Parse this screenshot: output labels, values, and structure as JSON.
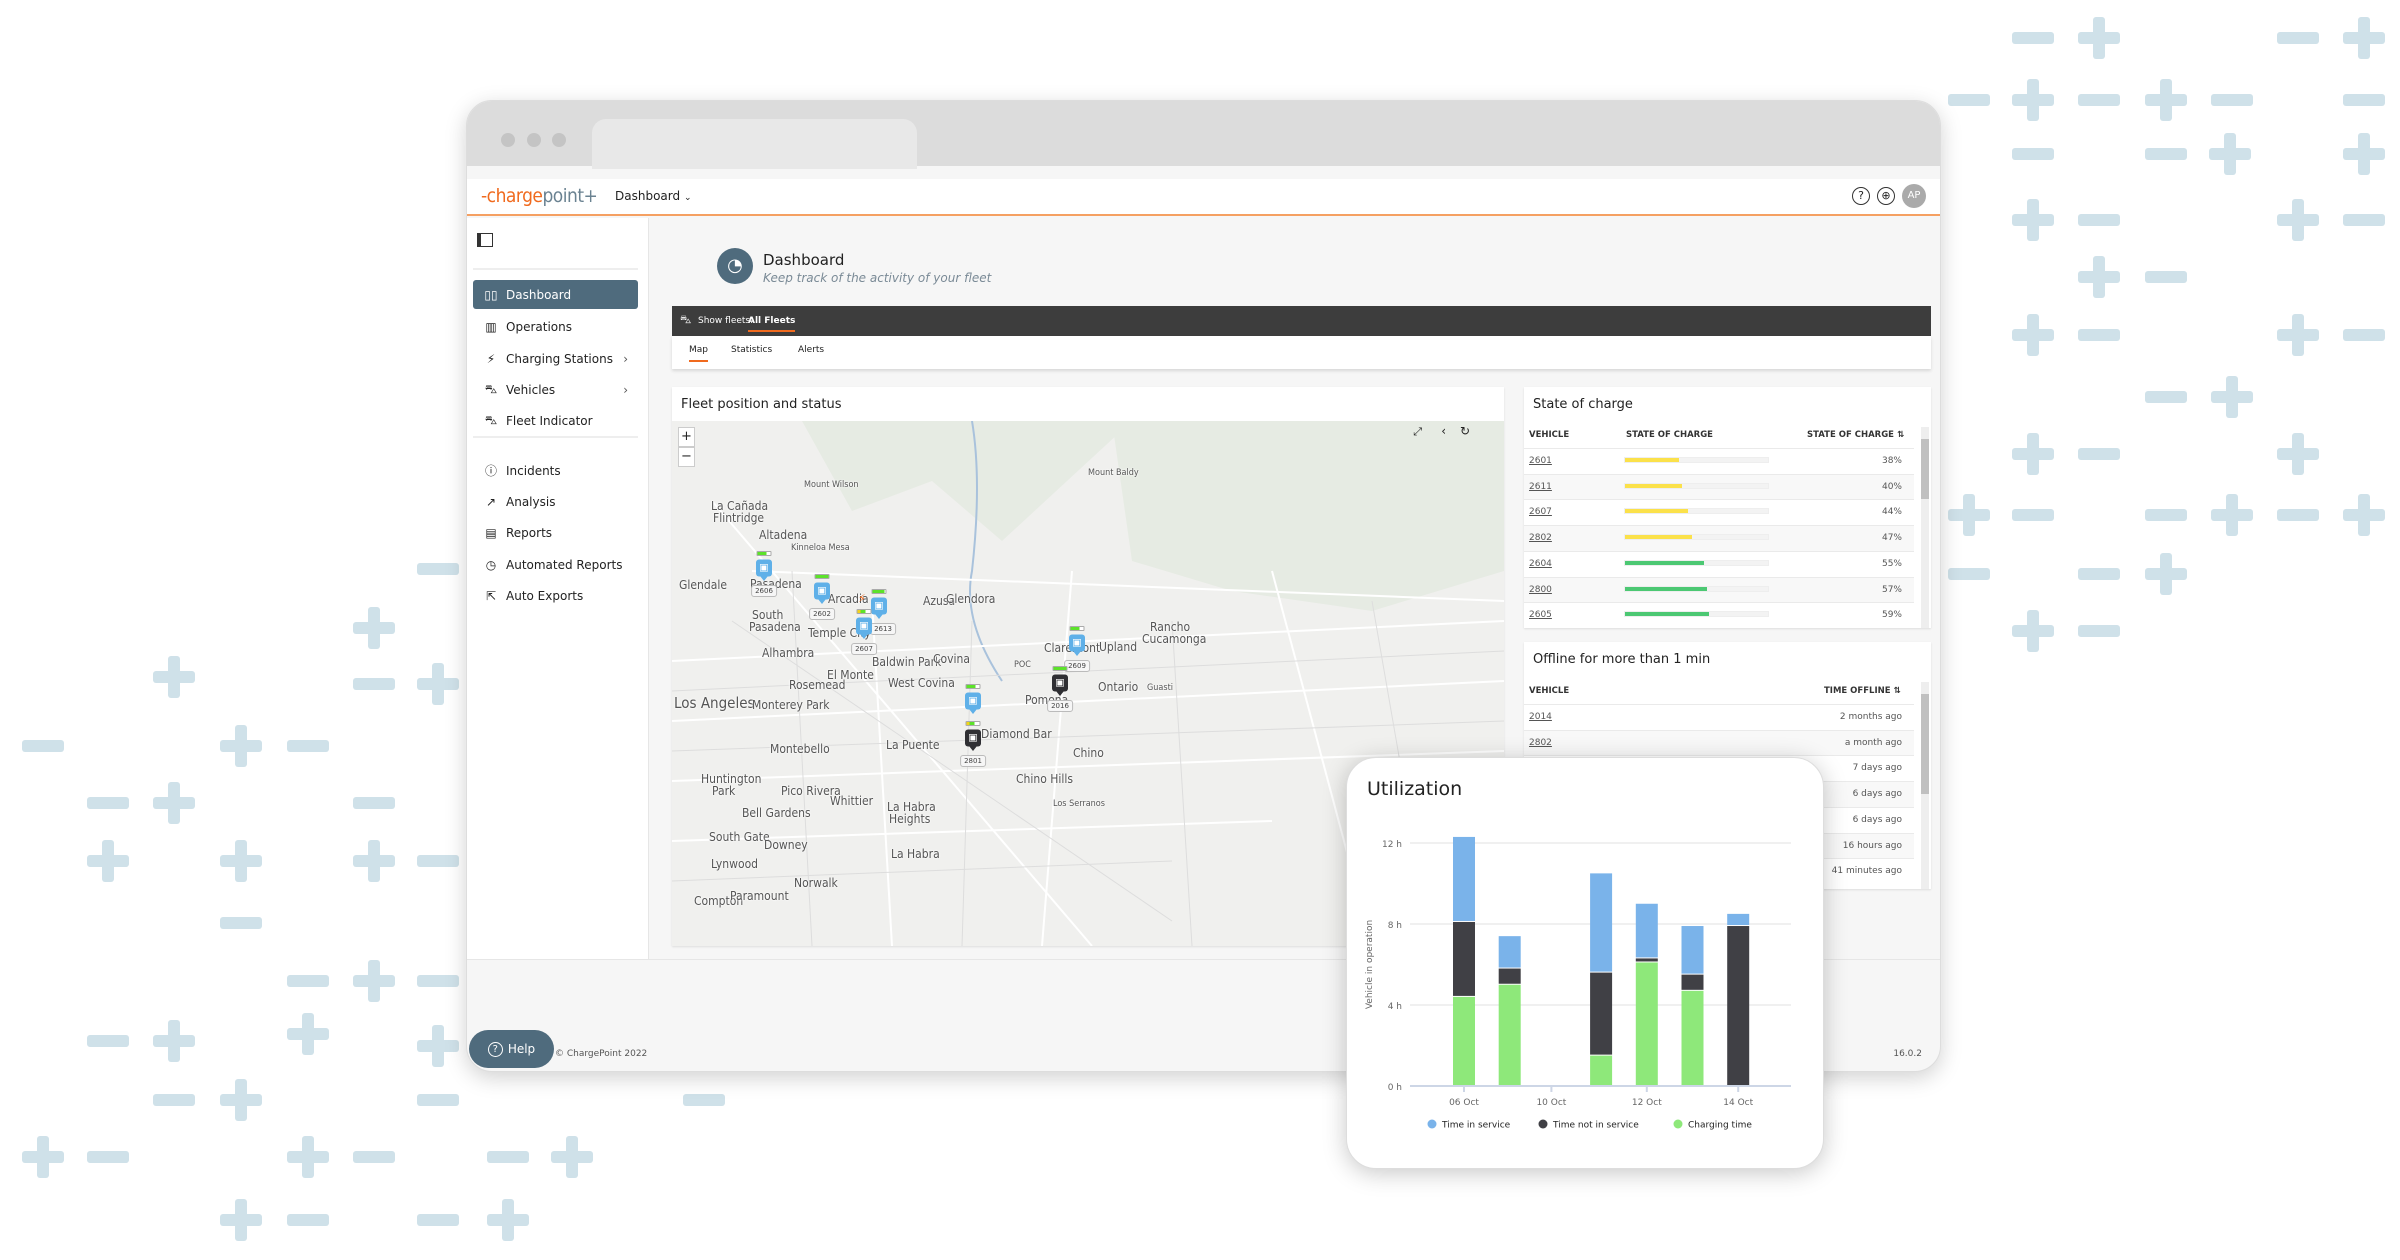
{
  "topbar": {
    "logo": "chargepoint",
    "page_menu": "Dashboard",
    "avatar": "AP"
  },
  "sidebar": {
    "items": [
      {
        "label": "Dashboard",
        "icon": "dashboard-icon",
        "active": true
      },
      {
        "label": "Operations",
        "icon": "map-icon"
      },
      {
        "label": "Charging Stations",
        "icon": "charging-station-icon",
        "has_submenu": true
      },
      {
        "label": "Vehicles",
        "icon": "bus-icon",
        "has_submenu": true
      },
      {
        "label": "Fleet Indicator",
        "icon": "fleet-icon"
      },
      {
        "label": "Incidents",
        "icon": "alert-circle-icon"
      },
      {
        "label": "Analysis",
        "icon": "chart-line-icon"
      },
      {
        "label": "Reports",
        "icon": "document-icon"
      },
      {
        "label": "Automated Reports",
        "icon": "clock-icon"
      },
      {
        "label": "Auto Exports",
        "icon": "export-icon"
      }
    ]
  },
  "header": {
    "title": "Dashboard",
    "subtitle": "Keep track of the activity of your fleet"
  },
  "fleetbar": {
    "label": "Show fleets:",
    "selected": "All Fleets"
  },
  "tabs": [
    {
      "label": "Map",
      "active": true
    },
    {
      "label": "Statistics"
    },
    {
      "label": "Alerts"
    }
  ],
  "map": {
    "title": "Fleet position and status",
    "labels": [
      "Mount Wilson",
      "Mount Baldy",
      "La Cañada",
      "Flintridge",
      "Altadena",
      "Kinneloa Mesa",
      "Glendale",
      "Pasadena",
      "Arcadia",
      "Azusa",
      "Glendora",
      "South",
      "Pasadena",
      "Temple City",
      "Alhambra",
      "Baldwin Park",
      "Covina",
      "El Monte",
      "Rosemead",
      "West Covina",
      "Claremont",
      "Upland",
      "Rancho",
      "Cucamonga",
      "Ontario",
      "Guasti",
      "POC",
      "Pomona",
      "Los Angeles",
      "Monterey Park",
      "Diamond Bar",
      "La Puente",
      "Montebello",
      "Chino",
      "Chino Hills",
      "Los Serranos",
      "Huntington",
      "Park",
      "Pico Rivera",
      "Whittier",
      "Bell Gardens",
      "La Habra",
      "Heights",
      "South Gate",
      "Downey",
      "La Habra",
      "Lynwood",
      "Norwalk",
      "Compton",
      "Paramount"
    ],
    "vehicles": [
      {
        "id": "2606",
        "status": "in-service",
        "battery": 0.7
      },
      {
        "id": "2602",
        "status": "in-service",
        "battery": 1.0
      },
      {
        "id": "2613",
        "status": "in-service",
        "battery": 0.9
      },
      {
        "id": "2607",
        "status": "charging",
        "battery": 0.6
      },
      {
        "id": "2609",
        "status": "in-service",
        "battery": 0.7
      },
      {
        "id": "2016",
        "status": "not-in-service",
        "battery": 1.0
      },
      {
        "id": "",
        "status": "in-service",
        "battery": 0.7
      },
      {
        "id": "2801",
        "status": "not-in-service",
        "battery": 0.6
      }
    ]
  },
  "soc": {
    "title": "State of charge",
    "headers": [
      "VEHICLE",
      "STATE OF CHARGE",
      "STATE OF CHARGE"
    ],
    "rows": [
      {
        "vehicle": "2601",
        "value": "38%",
        "pct": 38,
        "color": "#fbe14a"
      },
      {
        "vehicle": "2611",
        "value": "40%",
        "pct": 40,
        "color": "#fbe14a"
      },
      {
        "vehicle": "2607",
        "value": "44%",
        "pct": 44,
        "color": "#fbe14a"
      },
      {
        "vehicle": "2802",
        "value": "47%",
        "pct": 47,
        "color": "#fbe14a"
      },
      {
        "vehicle": "2604",
        "value": "55%",
        "pct": 55,
        "color": "#4cc873"
      },
      {
        "vehicle": "2800",
        "value": "57%",
        "pct": 57,
        "color": "#4cc873"
      },
      {
        "vehicle": "2605",
        "value": "59%",
        "pct": 59,
        "color": "#4cc873"
      }
    ]
  },
  "offline": {
    "title": "Offline for more than 1 min",
    "headers": [
      "VEHICLE",
      "TIME OFFLINE"
    ],
    "rows": [
      {
        "vehicle": "2014",
        "time": "2 months ago"
      },
      {
        "vehicle": "2802",
        "time": "a month ago"
      },
      {
        "vehicle": "",
        "time": "7 days ago"
      },
      {
        "vehicle": "",
        "time": "6 days ago"
      },
      {
        "vehicle": "",
        "time": "6 days ago"
      },
      {
        "vehicle": "",
        "time": "16 hours ago"
      },
      {
        "vehicle": "",
        "time": "41 minutes ago"
      }
    ]
  },
  "footer": {
    "copyright": "© ChargePoint 2022",
    "version": "16.0.2",
    "help": "Help"
  },
  "chart_data": {
    "type": "bar",
    "stacked": true,
    "title": "Utilization",
    "ylabel": "Vehicle in operation",
    "xlabel": "",
    "categories": [
      "06 Oct",
      "",
      "10 Oct",
      "",
      "12 Oct",
      "",
      "14 Oct"
    ],
    "ylim": [
      0,
      12
    ],
    "y_ticks": [
      "0 h",
      "4 h",
      "8 h",
      "12 h"
    ],
    "y_tick_values": [
      0,
      4,
      8,
      12
    ],
    "grid": true,
    "legend": "bottom",
    "series": [
      {
        "name": "Charging time",
        "color": "#8ee87a",
        "values": [
          4.4,
          5.0,
          null,
          1.5,
          6.1,
          4.7,
          0
        ]
      },
      {
        "name": "Time not in service",
        "color": "#404045",
        "values": [
          3.7,
          0.8,
          null,
          4.1,
          0.2,
          0.8,
          7.9
        ]
      },
      {
        "name": "Time in service",
        "color": "#7ab3ea",
        "values": [
          4.2,
          1.6,
          null,
          4.9,
          2.7,
          2.4,
          0.6
        ]
      }
    ],
    "legend_order": [
      "Time in service",
      "Time not in service",
      "Charging time"
    ]
  }
}
